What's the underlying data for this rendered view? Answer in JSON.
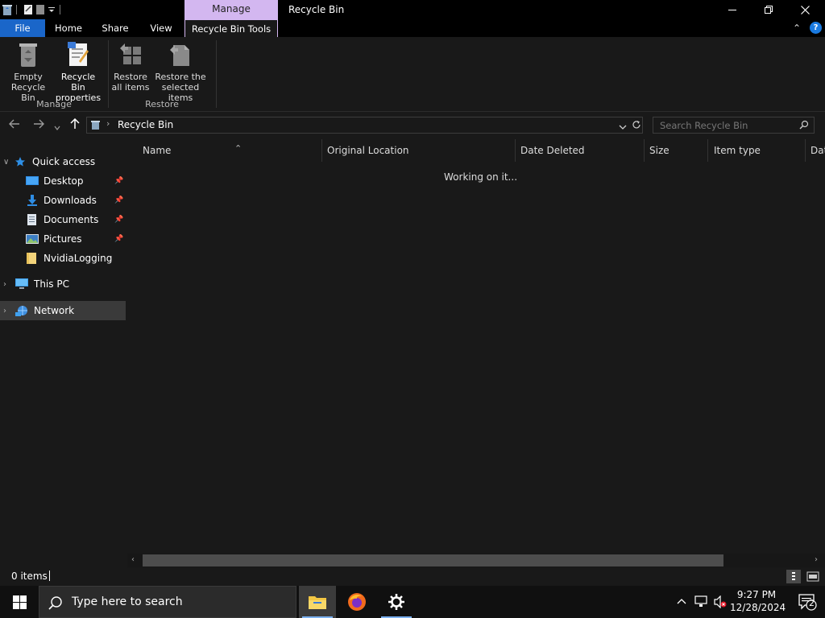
{
  "window": {
    "title": "Recycle Bin",
    "context_tab_group": "Manage"
  },
  "ribbon_tabs": {
    "file": "File",
    "home": "Home",
    "share": "Share",
    "view": "View",
    "recycle_bin_tools": "Recycle Bin Tools"
  },
  "ribbon": {
    "empty_recycle_bin": [
      "Empty",
      "Recycle Bin"
    ],
    "recycle_bin_properties": [
      "Recycle Bin",
      "properties"
    ],
    "restore_all_items": [
      "Restore",
      "all items"
    ],
    "restore_selected_items": [
      "Restore the",
      "selected items"
    ],
    "group_manage": "Manage",
    "group_restore": "Restore"
  },
  "address_bar": {
    "path": "Recycle Bin",
    "search_placeholder": "Search Recycle Bin"
  },
  "nav_pane": {
    "quick_access": "Quick access",
    "items": [
      {
        "label": "Desktop",
        "pinned": true
      },
      {
        "label": "Downloads",
        "pinned": true
      },
      {
        "label": "Documents",
        "pinned": true
      },
      {
        "label": "Pictures",
        "pinned": true
      },
      {
        "label": "NvidiaLogging",
        "pinned": false
      }
    ],
    "this_pc": "This PC",
    "network": "Network"
  },
  "columns": {
    "name": "Name",
    "original_location": "Original Location",
    "date_deleted": "Date Deleted",
    "size": "Size",
    "item_type": "Item type",
    "date_modified_partial": "Dat"
  },
  "content": {
    "status_message": "Working on it..."
  },
  "status_bar": {
    "item_count": "0 items"
  },
  "taskbar": {
    "search_text": "Type here to search",
    "time": "9:27 PM",
    "date": "12/28/2024",
    "notification_count": "2"
  },
  "colors": {
    "accent_file_tab": "#1a66c9",
    "context_tab": "#d3b7f0",
    "background": "#191919"
  }
}
